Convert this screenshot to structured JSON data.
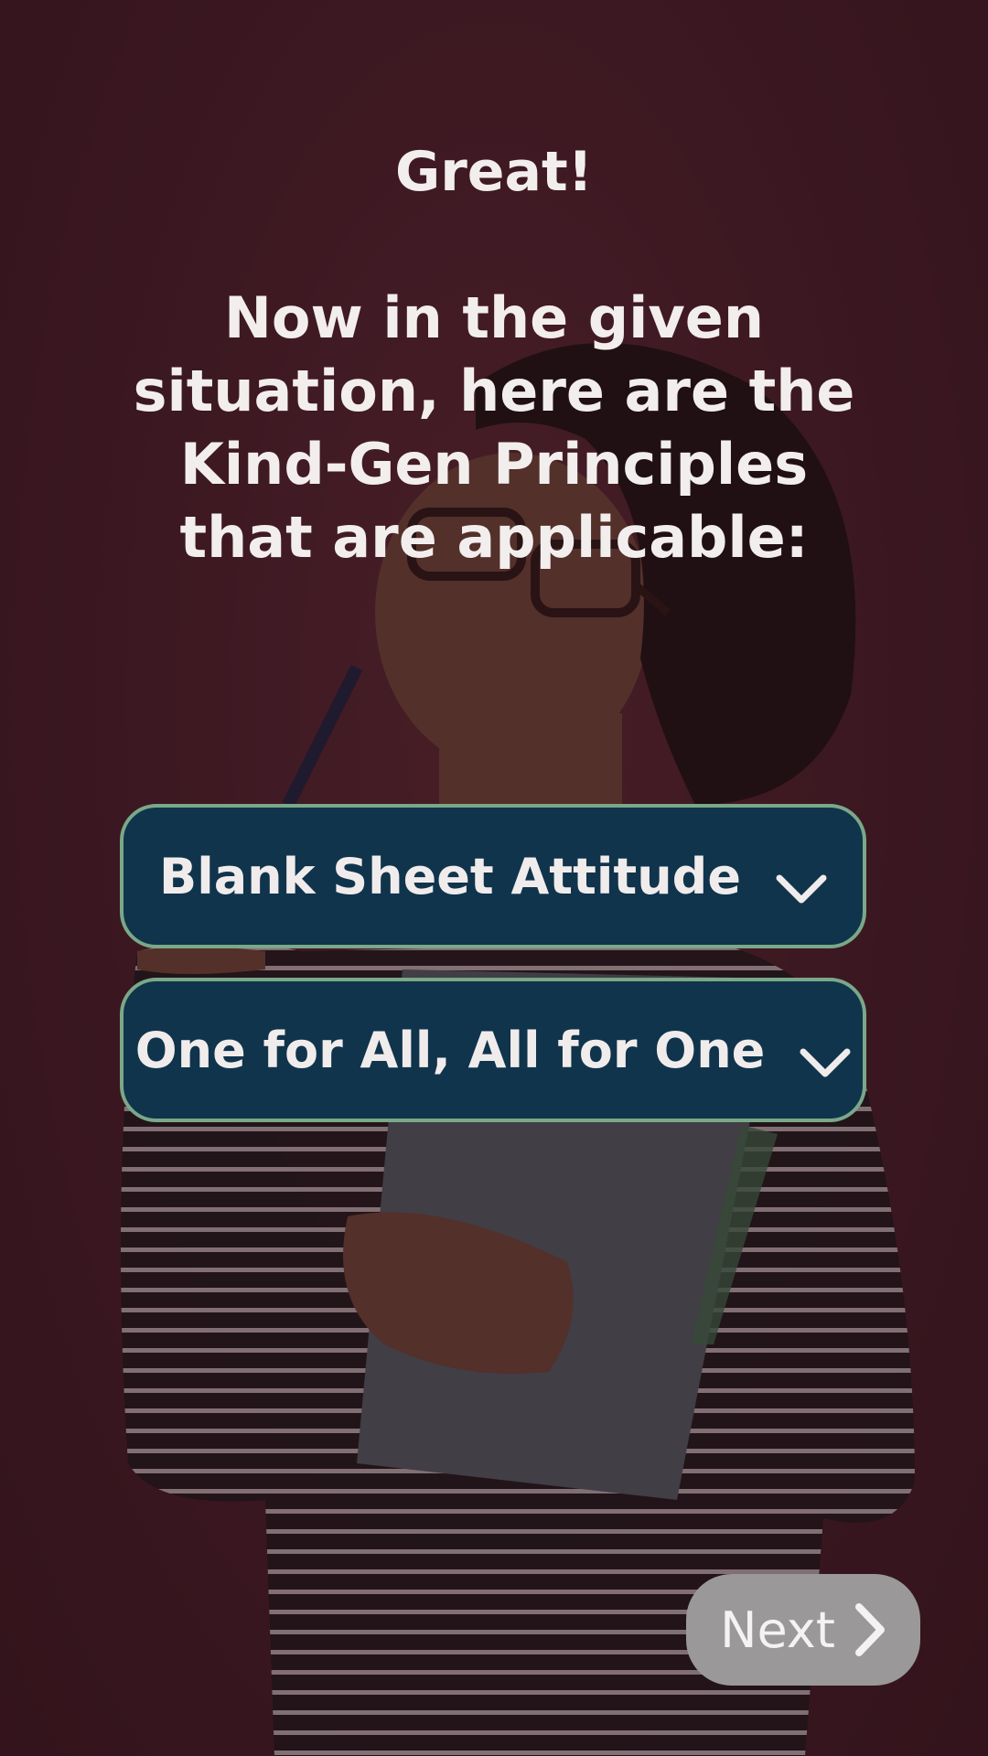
{
  "header": {
    "title": "Great!",
    "prompt": "Now in the given situation, here are the Kind-Gen Principles that are applicable:"
  },
  "principles": [
    {
      "label": "Blank Sheet Attitude",
      "icon": "chevron-down-icon"
    },
    {
      "label": "One for All, All for One",
      "icon": "chevron-down-icon"
    }
  ],
  "footer": {
    "next_label": "Next",
    "next_icon": "chevron-right-icon"
  },
  "colors": {
    "background": "#4a1f28",
    "button_fill": "#10344c",
    "button_border": "#7aa888",
    "next_fill": "#9a9898",
    "text": "#f1ecec"
  }
}
